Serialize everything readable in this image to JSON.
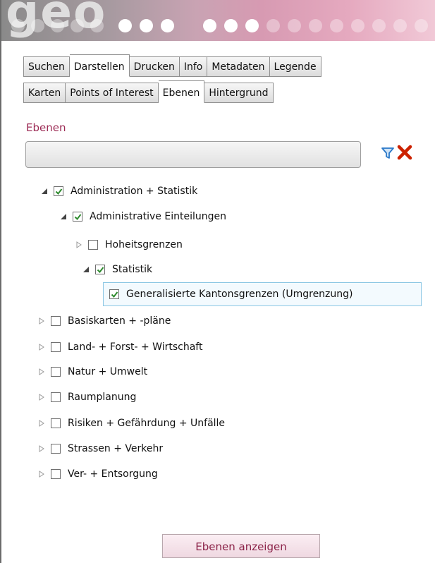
{
  "header": {
    "logo_text": "geo"
  },
  "tabs_row1": [
    "Suchen",
    "Darstellen",
    "Drucken",
    "Info",
    "Metadaten",
    "Legende"
  ],
  "tabs_row2": [
    "Karten",
    "Points of Interest",
    "Ebenen",
    "Hintergrund"
  ],
  "active_tab_row1": "Darstellen",
  "active_tab_row2": "Ebenen",
  "section": {
    "title": "Ebenen"
  },
  "filter": {
    "value": "",
    "filter_icon": "filter-icon",
    "clear_icon": "clear-icon"
  },
  "tree": [
    {
      "label": "Administration + Statistik",
      "expanded": true,
      "checked": true,
      "level": 0
    },
    {
      "label": "Administrative Einteilungen",
      "expanded": true,
      "checked": true,
      "level": 1
    },
    {
      "label": "Hoheitsgrenzen",
      "expanded": false,
      "checked": false,
      "level": 2
    },
    {
      "label": "Statistik",
      "expanded": true,
      "checked": true,
      "level": 2
    },
    {
      "label": "Generalisierte Kantonsgrenzen (Umgrenzung)",
      "leaf": true,
      "checked": true,
      "selected": true,
      "level": 3
    },
    {
      "label": "Basiskarten + -pläne",
      "expanded": false,
      "checked": false,
      "level": 0
    },
    {
      "label": "Land- + Forst- + Wirtschaft",
      "expanded": false,
      "checked": false,
      "level": 0
    },
    {
      "label": "Natur + Umwelt",
      "expanded": false,
      "checked": false,
      "level": 0
    },
    {
      "label": "Raumplanung",
      "expanded": false,
      "checked": false,
      "level": 0
    },
    {
      "label": "Risiken + Gefährdung + Unfälle",
      "expanded": false,
      "checked": false,
      "level": 0
    },
    {
      "label": "Strassen + Verkehr",
      "expanded": false,
      "checked": false,
      "level": 0
    },
    {
      "label": "Ver- + Entsorgung",
      "expanded": false,
      "checked": false,
      "level": 0
    }
  ],
  "buttons": {
    "show_layers": "Ebenen anzeigen"
  },
  "colors": {
    "accent": "#9c2a54",
    "check": "#2e8b2e",
    "clear": "#cc2200",
    "filter": "#2a78c8"
  }
}
